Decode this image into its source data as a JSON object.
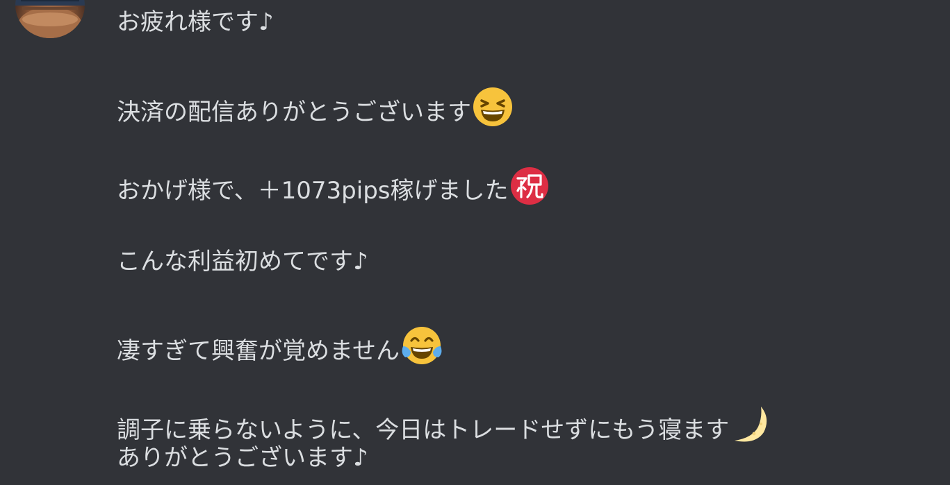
{
  "message": {
    "lines": [
      {
        "text": "お疲れ様です♪"
      },
      {
        "text": "決済の配信ありがとうございます",
        "emoji": "laughing-face-icon"
      },
      {
        "text": "おかげ様で、＋1073pips稼げました",
        "emoji": "congratulations-ideograph-icon"
      },
      {
        "text": "こんな利益初めてです♪"
      },
      {
        "text": "凄すぎて興奮が覚めません",
        "emoji": "tears-of-joy-face-icon"
      },
      {
        "text": "調子に乗らないように、今日はトレードせずにもう寝ます",
        "emoji": "crescent-moon-icon"
      },
      {
        "text": "ありがとうございます♪"
      }
    ]
  },
  "colors": {
    "background": "#313338",
    "text": "#dbdee1",
    "emoji_yellow": "#f7c33c",
    "emoji_red": "#dd2e44"
  }
}
